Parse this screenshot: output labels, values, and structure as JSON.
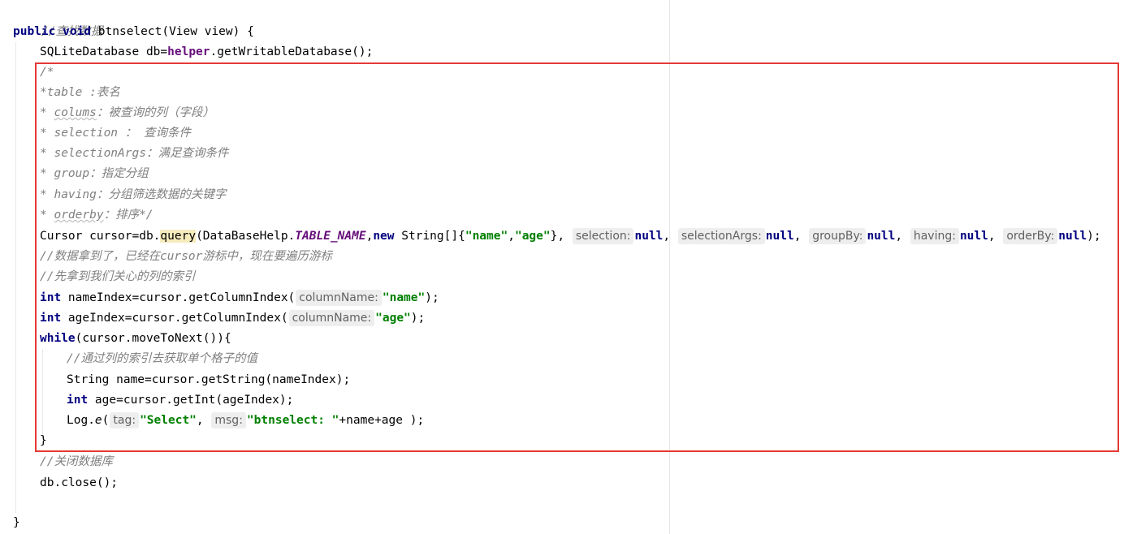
{
  "code": {
    "l01": "//查找数据",
    "l02_kw1": "public",
    "l02_kw2": "void",
    "l02_rest": " btnselect(View view) {",
    "l03_a": "SQLiteDatabase db=",
    "l03_field": "helper",
    "l03_b": ".getWritableDatabase();",
    "l04": "/*",
    "l05": "*table :表名",
    "l06_a": "* ",
    "l06_word": "colums",
    "l06_b": "：被查询的列（字段）",
    "l07": "* selection ： 查询条件",
    "l08": "* selectionArgs：满足查询条件",
    "l09": "* group：指定分组",
    "l10": "* having：分组筛选数据的关键字",
    "l11_a": "* ",
    "l11_word": "orderby",
    "l11_b": "：排序*/",
    "l12_a": "Cursor cursor=db.",
    "l12_method": "query",
    "l12_b": "(DataBaseHelp.",
    "l12_const": "TABLE_NAME",
    "l12_c": ",",
    "l12_kw": "new",
    "l12_d": " String[]{",
    "l12_s1": "\"name\"",
    "l12_e": ",",
    "l12_s2": "\"age\"",
    "l12_f": "},",
    "l12_h1": "selection:",
    "l12_null": "null",
    "l12_comma": ",",
    "l12_h2": "selectionArgs:",
    "l12_h3": "groupBy:",
    "l12_h4": "having:",
    "l12_h5": "orderBy:",
    "l12_end": ");",
    "l13": "//数据拿到了，已经在cursor游标中，现在要遍历游标",
    "l14": "//先拿到我们关心的列的索引",
    "l15_kw": "int",
    "l15_a": " nameIndex=cursor.getColumnIndex(",
    "l15_hint": "columnName:",
    "l15_str": "\"name\"",
    "l15_end": ");",
    "l16_kw": "int",
    "l16_a": " ageIndex=cursor.getColumnIndex(",
    "l16_hint": "columnName:",
    "l16_str": "\"age\"",
    "l16_end": ");",
    "l17_kw": "while",
    "l17_a": "(cursor.moveToNext()){",
    "l18": "//通过列的索引去获取单个格子的值",
    "l19": "String name=cursor.getString(nameIndex);",
    "l20_kw": "int",
    "l20_a": " age=cursor.getInt(ageIndex);",
    "l21_a": "Log.",
    "l21_m": "e",
    "l21_b": "(",
    "l21_hint1": "tag:",
    "l21_s1": "\"Select\"",
    "l21_c": ",",
    "l21_hint2": "msg:",
    "l21_s2": "\"btnselect: \"",
    "l21_d": "+name+age );",
    "l22": "}",
    "l23": "//关闭数据库",
    "l24": "db.close();",
    "l26": "}"
  },
  "colors": {
    "keyword": "#000080",
    "string": "#008000",
    "comment": "#808080",
    "field": "#660e7a",
    "highlight_box": "#e53935"
  }
}
